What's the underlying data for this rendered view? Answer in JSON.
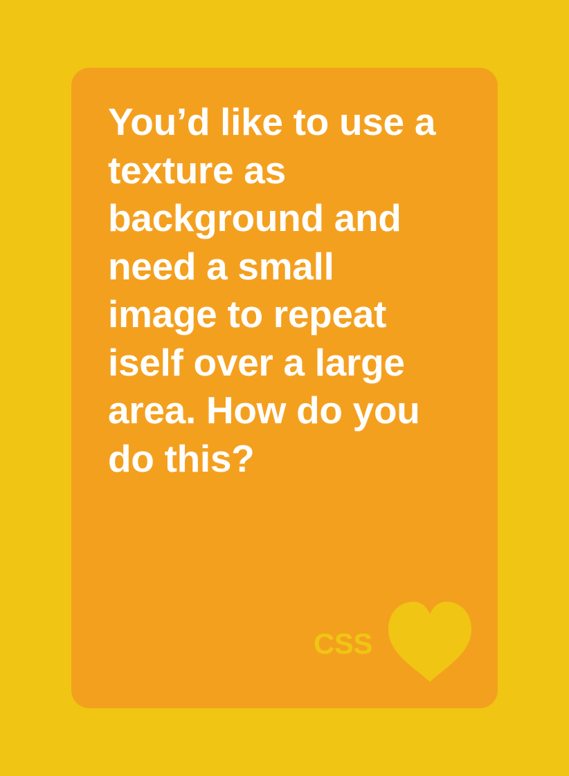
{
  "card": {
    "question_lines": [
      "You’d like to use a",
      "texture as",
      "background and",
      "need a small",
      "image to repeat",
      "iself over a large",
      "area. How do you",
      "do this?"
    ],
    "brand_label": "CSS",
    "brand_icon": "heart-icon",
    "colors": {
      "page_background": "#F0C514",
      "card_background": "#F4A01F",
      "text": "#FFFFFF",
      "brand": "#F0C514"
    }
  }
}
